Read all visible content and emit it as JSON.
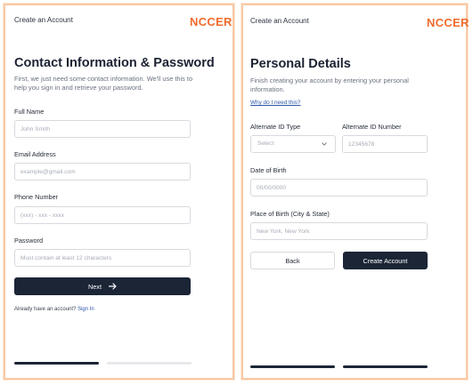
{
  "contact": {
    "header_title": "Create an Account",
    "logo": "NCCER",
    "heading": "Contact Information & Password",
    "subtitle": "First, we just need some contact information. We'll use this to help you sign in and retrieve your password.",
    "fields": [
      {
        "label": "Full Name",
        "placeholder": "John Smith"
      },
      {
        "label": "Email Address",
        "placeholder": "example@gmail.com"
      },
      {
        "label": "Phone Number",
        "placeholder": "(xxx) - xxx - xxxx"
      },
      {
        "label": "Password",
        "placeholder": "Must contain at least 12 characters"
      }
    ],
    "next_label": "Next",
    "signin_prompt": "Already have an account?",
    "signin_link": "Sign In"
  },
  "personal": {
    "header_title": "Create an Account",
    "logo": "NCCER",
    "heading": "Personal Details",
    "subtitle": "Finish creating your account by entering your personal information.",
    "why_link": "Why do I need this?",
    "alt_id_type": {
      "label": "Alternate ID Type",
      "value": "Select"
    },
    "alt_id_number": {
      "label": "Alternate ID Number",
      "placeholder": "12345678"
    },
    "dob": {
      "label": "Date of Birth",
      "placeholder": "00/00/0000"
    },
    "pob": {
      "label": "Place of Birth (City & State)",
      "placeholder": "New York, New York"
    },
    "back_label": "Back",
    "create_label": "Create Account"
  },
  "progress": {
    "contact_steps_done": 1,
    "personal_steps_done": 2,
    "total_steps": 2
  },
  "colors": {
    "accent": "#f06b2c",
    "primary": "#1b2536",
    "link": "#2c56a8",
    "panel_border": "#f7c9a5"
  },
  "icons": {
    "next": "arrow-right-icon",
    "select": "chevron-down-icon"
  }
}
